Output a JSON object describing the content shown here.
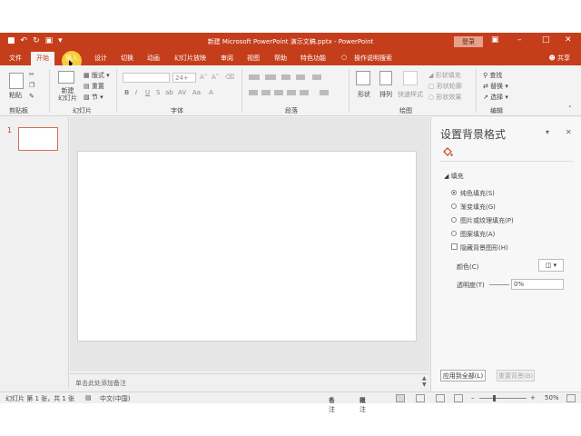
{
  "window": {
    "title": "新建 Microsoft PowerPoint 演示文稿.pptx - PowerPoint",
    "login_label": "登录"
  },
  "tabs": [
    {
      "label": "文件"
    },
    {
      "label": "开始"
    },
    {
      "label": "插入"
    },
    {
      "label": "设计"
    },
    {
      "label": "切换"
    },
    {
      "label": "动画"
    },
    {
      "label": "幻灯片放映"
    },
    {
      "label": "审阅"
    },
    {
      "label": "视图"
    },
    {
      "label": "帮助"
    },
    {
      "label": "特色功能"
    }
  ],
  "tell_me": "操作说明搜索",
  "share_label": "共享",
  "ribbon": {
    "paste_label": "粘贴",
    "clipboard_group": "剪贴板",
    "new_slide_label": "新建\n幻灯片",
    "new_slide_line1": "新建",
    "new_slide_line2": "幻灯片",
    "layout_label": "版式",
    "reset_label": "重置",
    "section_label": "节",
    "slides_group": "幻灯片",
    "font_size": "24+",
    "font_group": "字体",
    "paragraph_group": "段落",
    "shapes_label": "形状",
    "arrange_label": "排列",
    "quick_styles_label": "快速样式",
    "drawing_group": "绘图",
    "shape_fill": "形状填充",
    "shape_outline": "形状轮廓",
    "shape_effect": "形状效果",
    "find_label": "查找",
    "replace_label": "替换",
    "select_label": "选择",
    "editing_group": "编辑"
  },
  "thumbnails": {
    "slide_number": "1"
  },
  "notes_placeholder": "单击此处添加备注",
  "format_pane": {
    "title": "设置背景格式",
    "fill_section": "填充",
    "options": [
      {
        "label": "纯色填充(S)",
        "checked": true
      },
      {
        "label": "渐变填充(G)",
        "checked": false
      },
      {
        "label": "图片或纹理填充(P)",
        "checked": false
      },
      {
        "label": "图案填充(A)",
        "checked": false
      }
    ],
    "hide_bg_label": "隐藏背景图形(H)",
    "color_label": "颜色(C)",
    "transparency_label": "透明度(T)",
    "transparency_value": "0%",
    "apply_all_label": "应用到全部(L)",
    "reset_bg_label": "重置背景(B)"
  },
  "status": {
    "slide_info": "幻灯片 第 1 张，共 1 张",
    "language": "中文(中国)",
    "notes_label": "备注",
    "comments_label": "批注",
    "zoom": "50%"
  },
  "colors": {
    "accent": "#c43e1c",
    "selection": "#d2704e"
  }
}
